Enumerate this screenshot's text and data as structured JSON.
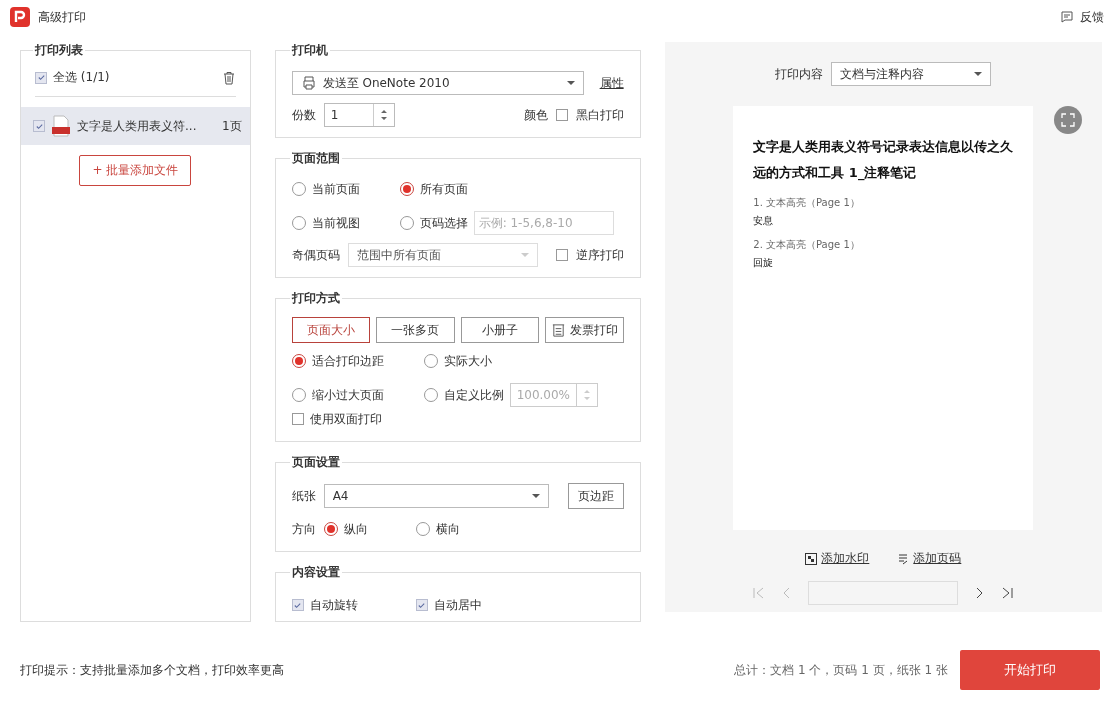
{
  "window": {
    "title": "高级打印",
    "feedback": "反馈"
  },
  "print_list": {
    "title": "打印列表",
    "select_all": {
      "label": "全选 (1/1)",
      "checked": true
    },
    "files": [
      {
        "name": "文字是人类用表义符...",
        "pages": "1页",
        "checked": true,
        "selected": true
      }
    ],
    "add_button": "+ 批量添加文件"
  },
  "printer": {
    "title": "打印机",
    "device": "发送至 OneNote 2010",
    "properties_link": "属性",
    "copies_label": "份数",
    "copies": "1",
    "color_label": "颜色",
    "mono": {
      "label": "黑白打印",
      "checked": false
    }
  },
  "page_range": {
    "title": "页面范围",
    "options": [
      {
        "label": "当前页面",
        "selected": false
      },
      {
        "label": "所有页面",
        "selected": true
      },
      {
        "label": "当前视图",
        "selected": false
      },
      {
        "label": "页码选择",
        "selected": false
      }
    ],
    "pages_placeholder": "示例: 1-5,6,8-10",
    "odd_even_label": "奇偶页码",
    "odd_even": "范围中所有页面",
    "reverse": {
      "label": "逆序打印",
      "checked": false
    }
  },
  "print_mode": {
    "title": "打印方式",
    "modes": [
      {
        "label": "页面大小",
        "selected": true,
        "kind": "text"
      },
      {
        "label": "一张多页",
        "selected": false,
        "kind": "text"
      },
      {
        "label": "小册子",
        "selected": false,
        "kind": "text"
      },
      {
        "label": "发票打印",
        "selected": false,
        "kind": "invoice"
      }
    ],
    "scales": [
      {
        "label": "适合打印边距",
        "selected": true
      },
      {
        "label": "实际大小",
        "selected": false
      },
      {
        "label": "缩小过大页面",
        "selected": false
      },
      {
        "label": "自定义比例",
        "selected": false
      }
    ],
    "custom_scale": "100.00%",
    "duplex": {
      "label": "使用双面打印",
      "checked": false
    }
  },
  "page_setup": {
    "title": "页面设置",
    "paper_label": "纸张",
    "paper": "A4",
    "margins_button": "页边距",
    "orientation_label": "方向",
    "orientations": [
      {
        "label": "纵向",
        "selected": true
      },
      {
        "label": "横向",
        "selected": false
      }
    ]
  },
  "content_setup": {
    "title": "内容设置",
    "options": [
      {
        "label": "自动旋转",
        "checked": true
      },
      {
        "label": "自动居中",
        "checked": true
      }
    ]
  },
  "preview": {
    "content_label": "打印内容",
    "content": "文档与注释内容",
    "page": {
      "title": "文字是人类用表义符号记录表达信息以传之久远的方式和工具 1_注释笔记",
      "notes": [
        {
          "head": "1. 文本高亮（Page 1）",
          "text": "安息"
        },
        {
          "head": "2. 文本高亮（Page 1）",
          "text": "回旋"
        }
      ]
    },
    "add_watermark": "添加水印",
    "add_page_number": "添加页码"
  },
  "footer": {
    "tip": "打印提示：支持批量添加多个文档，打印效率更高",
    "summary": "总计：文档 1 个，页码 1 页，纸张 1 张",
    "start_button": "开始打印"
  }
}
